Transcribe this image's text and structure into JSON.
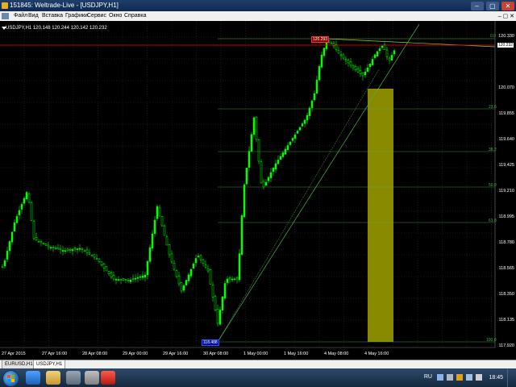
{
  "window": {
    "title": "151845: Weltrade-Live - [USDJPY,H1]",
    "buttons": [
      "–",
      "▢",
      "✕"
    ]
  },
  "menu": {
    "items": [
      "Файл",
      "Вид",
      "Вставка",
      "Графики",
      "Сервис",
      "Окно",
      "Справка"
    ],
    "mdi_controls": "– ▢ ✕"
  },
  "chart": {
    "symbol_label": "USDJPY,H1  120.148 120.244 120.142 120.232",
    "current_price_tag": "120.232",
    "high_tag": "120.293",
    "low_tag": "118.488",
    "price_ticks": [
      "120.330",
      "120.232",
      "120.070",
      "119.855",
      "119.640",
      "119.425",
      "119.210",
      "118.995",
      "118.780",
      "118.565",
      "118.350",
      "118.135",
      "117.920"
    ],
    "date_ticks": [
      "27 Apr 2015",
      "27 Apr 16:00",
      "28 Apr 08:00",
      "29 Apr 00:00",
      "29 Apr 16:00",
      "30 Apr 08:00",
      "1 May 00:00",
      "1 May 16:00",
      "4 May 08:00",
      "4 May 16:00"
    ],
    "fib_levels": [
      "0.0",
      "23.6",
      "38.2",
      "50.0",
      "61.8",
      "100.0"
    ],
    "colors": {
      "background": "#000000",
      "candle": "#00ff00",
      "grid": "#2a2a2a",
      "current_price_line": "#ff0000",
      "fib": "#4caf50",
      "rectangle": "#8a8a00"
    }
  },
  "tabs": [
    "EURUSD,H1",
    "USDJPY,H1"
  ],
  "taskbar": {
    "language": "RU",
    "time": "18:45"
  }
}
